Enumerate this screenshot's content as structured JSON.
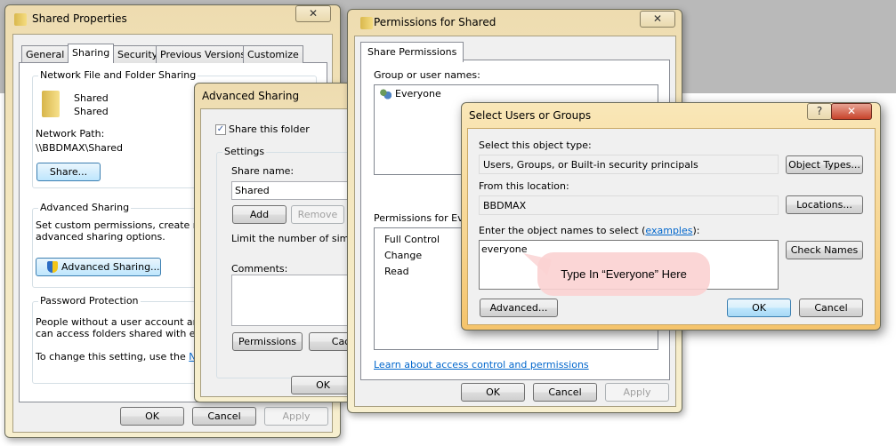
{
  "shared_properties": {
    "title": "Shared Properties",
    "tabs": [
      "General",
      "Sharing",
      "Security",
      "Previous Versions",
      "Customize"
    ],
    "nffs": {
      "label": "Network File and Folder Sharing",
      "name1": "Shared",
      "name2": "Shared",
      "path_label": "Network Path:",
      "path": "\\\\BBDMAX\\Shared",
      "share_btn": "Share..."
    },
    "adv": {
      "label": "Advanced Sharing",
      "desc1": "Set custom permissions, create multip",
      "desc2": "advanced sharing options.",
      "btn": "Advanced Sharing..."
    },
    "pw": {
      "label": "Password Protection",
      "line1": "People without a user account and p",
      "line2": "can access folders shared with every",
      "line3": "To change this setting, use the ",
      "link": "Netw"
    },
    "ok": "OK",
    "cancel": "Cancel",
    "apply": "Apply"
  },
  "advanced_sharing": {
    "title": "Advanced Sharing",
    "share_check": "Share this folder",
    "checked": true,
    "settings": "Settings",
    "share_name_label": "Share name:",
    "share_name": "Shared",
    "add": "Add",
    "remove": "Remove",
    "limit": "Limit the number of simultar",
    "comments": "Comments:",
    "permissions": "Permissions",
    "caching": "Cach",
    "ok": "OK"
  },
  "permissions": {
    "title": "Permissions for Shared",
    "tab": "Share Permissions",
    "group_label": "Group or user names:",
    "groups": [
      "Everyone"
    ],
    "perm_label": "Permissions for Every",
    "perms": [
      "Full Control",
      "Change",
      "Read"
    ],
    "learn": "Learn about access control and permissions",
    "ok": "OK",
    "cancel": "Cancel",
    "apply": "Apply"
  },
  "select_users": {
    "title": "Select Users or Groups",
    "help": "?",
    "close": "X",
    "type_label": "Select this object type:",
    "type_value": "Users, Groups, or Built-in security principals",
    "object_types": "Object Types...",
    "loc_label": "From this location:",
    "loc_value": "BBDMAX",
    "locations": "Locations...",
    "enter_label": "Enter the object names to select (",
    "examples": "examples",
    "enter_suffix": "):",
    "names_value": "everyone",
    "check_names": "Check Names",
    "advanced": "Advanced...",
    "ok": "OK",
    "cancel": "Cancel"
  },
  "callout": {
    "text": "Type In “Everyone” Here",
    "color": "#fbd6d6"
  }
}
